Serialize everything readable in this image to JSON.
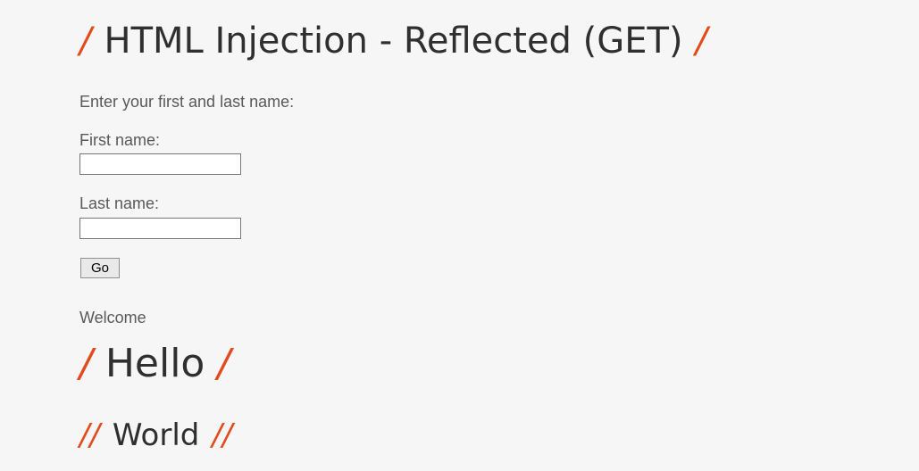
{
  "page": {
    "title": "HTML Injection - Reflected (GET)",
    "title_decoration": "/",
    "intro": "Enter your first and last name:"
  },
  "form": {
    "first_name_label": "First name:",
    "first_name_value": "",
    "last_name_label": "Last name:",
    "last_name_value": "",
    "submit_label": "Go"
  },
  "result": {
    "welcome": "Welcome",
    "hello": "Hello",
    "hello_decoration": "/",
    "world": "World",
    "world_decoration": "//"
  },
  "colors": {
    "background": "#f6f6f6",
    "text": "#595959",
    "heading": "#2f2f2f",
    "accent": "#e24c1d"
  }
}
